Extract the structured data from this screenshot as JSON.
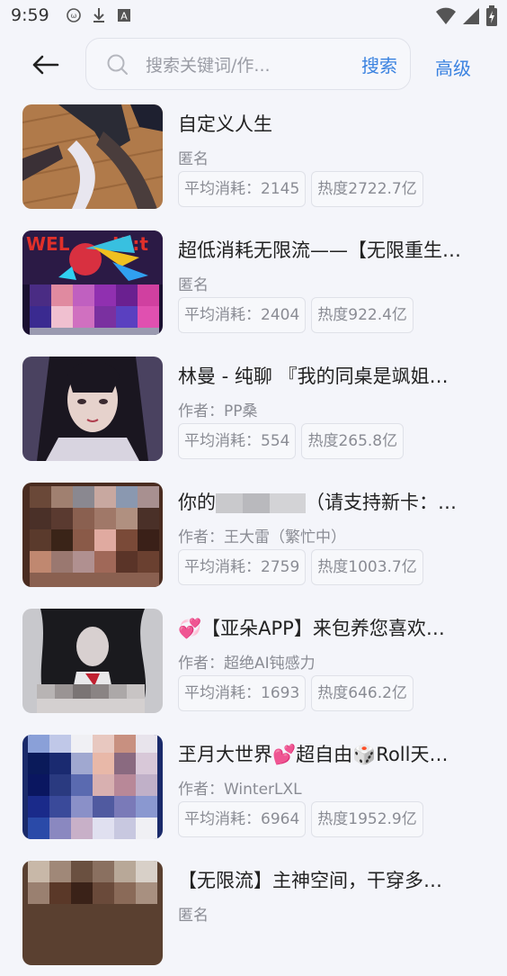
{
  "statusbar": {
    "time": "9:59",
    "icons": [
      "app-icon",
      "download-icon",
      "text-icon",
      "wifi-icon",
      "signal-icon",
      "battery-icon"
    ]
  },
  "header": {
    "back_icon": "arrow-left-icon",
    "search": {
      "placeholder": "搜索关键词/作...",
      "value": ""
    },
    "search_button": "搜索",
    "advanced_button": "高级"
  },
  "colors": {
    "accent": "#3a82e0",
    "background": "#f4f5fa",
    "title": "#222222",
    "meta": "#8a8c94"
  },
  "items": [
    {
      "title": "自定义人生",
      "author": "匿名",
      "tag1": "平均消耗：2145",
      "tag2": "热度2722.7亿",
      "thumb": "legs-stockings-image"
    },
    {
      "title": "超低消耗无限流——【无限重生…",
      "author": "匿名",
      "tag1": "平均消耗：2404",
      "tag2": "热度922.4亿",
      "thumb": "anime-rainbow-hair-image"
    },
    {
      "title": "林曼 - 纯聊 『我的同桌是飒姐…",
      "author": "作者：PP桑",
      "tag1": "平均消耗：554",
      "tag2": "热度265.8亿",
      "thumb": "portrait-dark-hair-image"
    },
    {
      "title_before": "你的",
      "title_after": "（请支持新卡：…",
      "author": "作者：王大雷（繁忙中）",
      "tag1": "平均消耗：2759",
      "tag2": "热度1003.7亿",
      "thumb": "mosaic-image"
    },
    {
      "title": "💞【亚朵APP】来包养您喜欢…",
      "author": "作者：超绝AI钝感力",
      "tag1": "平均消耗：1693",
      "tag2": "热度646.2亿",
      "thumb": "dark-hair-girl-image"
    },
    {
      "title": "玊月大世界💕超自由🎲Roll天…",
      "author": "作者：WinterLXL",
      "tag1": "平均消耗：6964",
      "tag2": "热度1952.9亿",
      "thumb": "blue-mosaic-image"
    },
    {
      "title": "【无限流】主神空间，干穿多…",
      "author": "匿名",
      "thumb": "brown-mosaic-image"
    }
  ]
}
